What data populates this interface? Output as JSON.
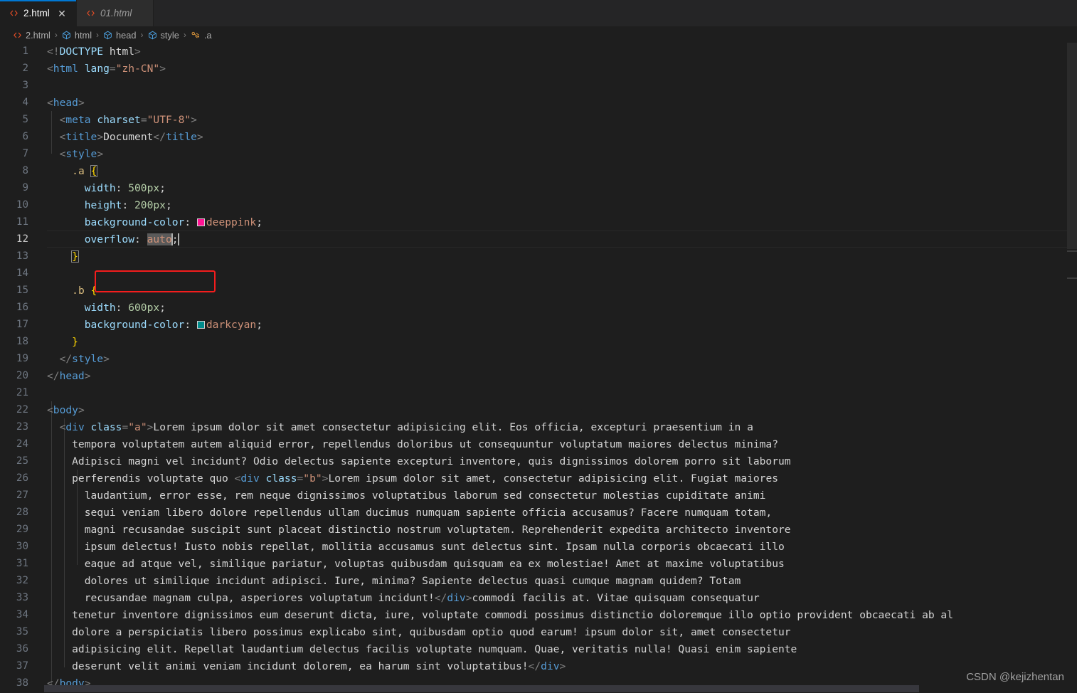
{
  "window": {
    "app": "Visual Studio Code",
    "accent_color": "#0078d4",
    "background": "#1e1e1e"
  },
  "tabs": [
    {
      "label": "2.html",
      "icon": "html-file-icon",
      "active": true,
      "preview": false,
      "close_glyph": "✕"
    },
    {
      "label": "01.html",
      "icon": "html-file-icon",
      "active": false,
      "preview": true,
      "close_glyph": "✕"
    }
  ],
  "breadcrumb": {
    "separator": "›",
    "items": [
      {
        "label": "2.html",
        "icon": "html-file-icon"
      },
      {
        "label": "html",
        "icon": "html-element-cube-icon"
      },
      {
        "label": "head",
        "icon": "html-element-cube-icon"
      },
      {
        "label": "style",
        "icon": "html-element-cube-icon"
      },
      {
        "label": ".a",
        "icon": "css-selector-icon"
      }
    ]
  },
  "editor": {
    "active_line": 12,
    "first_line": 1,
    "last_line": 38,
    "annotation": {
      "shape": "rectangle",
      "color": "#f41d1d",
      "target_line": 12,
      "target_text": "overflow: auto;"
    },
    "selection": {
      "line": 12,
      "text": "auto"
    },
    "color_swatches": [
      {
        "line": 11,
        "name": "deeppink",
        "hex": "#ff1493"
      },
      {
        "line": 17,
        "name": "darkcyan",
        "hex": "#008b8b"
      }
    ],
    "lines": [
      {
        "n": 1,
        "text": "<!DOCTYPE html>"
      },
      {
        "n": 2,
        "text": "<html lang=\"zh-CN\">"
      },
      {
        "n": 3,
        "text": ""
      },
      {
        "n": 4,
        "text": "<head>"
      },
      {
        "n": 5,
        "text": "  <meta charset=\"UTF-8\">"
      },
      {
        "n": 6,
        "text": "  <title>Document</title>"
      },
      {
        "n": 7,
        "text": "  <style>"
      },
      {
        "n": 8,
        "text": "    .a {"
      },
      {
        "n": 9,
        "text": "      width: 500px;"
      },
      {
        "n": 10,
        "text": "      height: 200px;"
      },
      {
        "n": 11,
        "text": "      background-color: deeppink;"
      },
      {
        "n": 12,
        "text": "      overflow: auto;"
      },
      {
        "n": 13,
        "text": "    }"
      },
      {
        "n": 14,
        "text": ""
      },
      {
        "n": 15,
        "text": "    .b {"
      },
      {
        "n": 16,
        "text": "      width: 600px;"
      },
      {
        "n": 17,
        "text": "      background-color: darkcyan;"
      },
      {
        "n": 18,
        "text": "    }"
      },
      {
        "n": 19,
        "text": "  </style>"
      },
      {
        "n": 20,
        "text": "</head>"
      },
      {
        "n": 21,
        "text": ""
      },
      {
        "n": 22,
        "text": "<body>"
      },
      {
        "n": 23,
        "text": "  <div class=\"a\">Lorem ipsum dolor sit amet consectetur adipisicing elit. Eos officia, excepturi praesentium in a"
      },
      {
        "n": 24,
        "text": "    tempora voluptatem autem aliquid error, repellendus doloribus ut consequuntur voluptatum maiores delectus minima?"
      },
      {
        "n": 25,
        "text": "    Adipisci magni vel incidunt? Odio delectus sapiente excepturi inventore, quis dignissimos dolorem porro sit laborum"
      },
      {
        "n": 26,
        "text": "    perferendis voluptate quo <div class=\"b\">Lorem ipsum dolor sit amet, consectetur adipisicing elit. Fugiat maiores"
      },
      {
        "n": 27,
        "text": "      laudantium, error esse, rem neque dignissimos voluptatibus laborum sed consectetur molestias cupiditate animi"
      },
      {
        "n": 28,
        "text": "      sequi veniam libero dolore repellendus ullam ducimus numquam sapiente officia accusamus? Facere numquam totam,"
      },
      {
        "n": 29,
        "text": "      magni recusandae suscipit sunt placeat distinctio nostrum voluptatem. Reprehenderit expedita architecto inventore"
      },
      {
        "n": 30,
        "text": "      ipsum delectus! Iusto nobis repellat, mollitia accusamus sunt delectus sint. Ipsam nulla corporis obcaecati illo"
      },
      {
        "n": 31,
        "text": "      eaque ad atque vel, similique pariatur, voluptas quibusdam quisquam ea ex molestiae! Amet at maxime voluptatibus"
      },
      {
        "n": 32,
        "text": "      dolores ut similique incidunt adipisci. Iure, minima? Sapiente delectus quasi cumque magnam quidem? Totam"
      },
      {
        "n": 33,
        "text": "      recusandae magnam culpa, asperiores voluptatum incidunt!</div>commodi facilis at. Vitae quisquam consequatur"
      },
      {
        "n": 34,
        "text": "    tenetur inventore dignissimos eum deserunt dicta, iure, voluptate commodi possimus distinctio doloremque illo optio provident obcaecati ab al"
      },
      {
        "n": 35,
        "text": "    dolore a perspiciatis libero possimus explicabo sint, quibusdam optio quod earum! ipsum dolor sit, amet consectetur"
      },
      {
        "n": 36,
        "text": "    adipisicing elit. Repellat laudantium delectus facilis voluptate numquam. Quae, veritatis nulla! Quasi enim sapiente"
      },
      {
        "n": 37,
        "text": "    deserunt velit animi veniam incidunt dolorem, ea harum sint voluptatibus!</div>"
      },
      {
        "n": 38,
        "text": "</body>"
      }
    ]
  },
  "watermark": {
    "text": "CSDN @kejizhentan"
  }
}
